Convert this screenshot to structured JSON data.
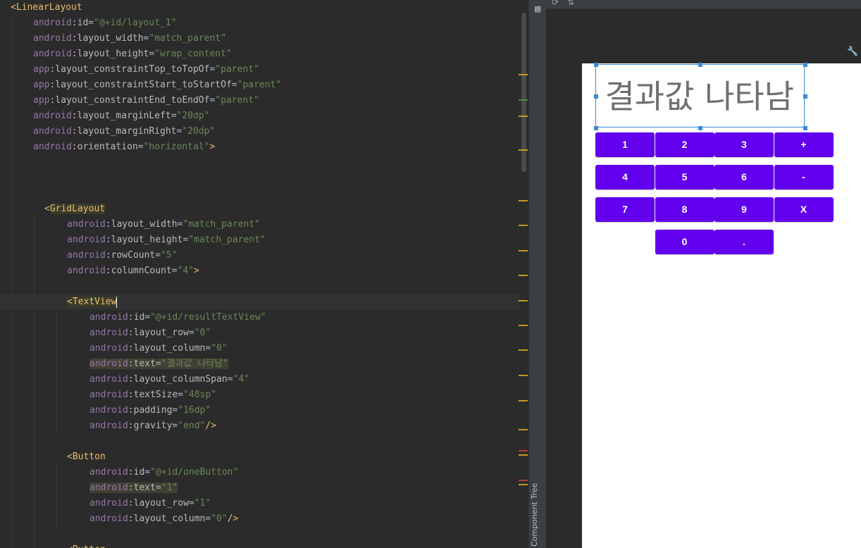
{
  "editor": {
    "lines": [
      {
        "indent": 0,
        "parts": [
          [
            "tag",
            "<LinearLayout"
          ]
        ]
      },
      {
        "indent": 1,
        "parts": [
          [
            "ns",
            "android"
          ],
          [
            "attr",
            ":id"
          ],
          [
            "eq",
            "="
          ],
          [
            "val",
            "\"@+id/layout_1\""
          ]
        ]
      },
      {
        "indent": 1,
        "parts": [
          [
            "ns",
            "android"
          ],
          [
            "attr",
            ":layout_width"
          ],
          [
            "eq",
            "="
          ],
          [
            "val",
            "\"match_parent\""
          ]
        ]
      },
      {
        "indent": 1,
        "parts": [
          [
            "ns",
            "android"
          ],
          [
            "attr",
            ":layout_height"
          ],
          [
            "eq",
            "="
          ],
          [
            "val",
            "\"wrap_content\""
          ]
        ]
      },
      {
        "indent": 1,
        "parts": [
          [
            "ns",
            "app"
          ],
          [
            "attr",
            ":layout_constraintTop_toTopOf"
          ],
          [
            "eq",
            "="
          ],
          [
            "val",
            "\"parent\""
          ]
        ]
      },
      {
        "indent": 1,
        "parts": [
          [
            "ns",
            "app"
          ],
          [
            "attr",
            ":layout_constraintStart_toStartOf"
          ],
          [
            "eq",
            "="
          ],
          [
            "val",
            "\"parent\""
          ]
        ]
      },
      {
        "indent": 1,
        "parts": [
          [
            "ns",
            "app"
          ],
          [
            "attr",
            ":layout_constraintEnd_toEndOf"
          ],
          [
            "eq",
            "="
          ],
          [
            "val",
            "\"parent\""
          ]
        ]
      },
      {
        "indent": 1,
        "parts": [
          [
            "ns",
            "android"
          ],
          [
            "attr",
            ":layout_marginLeft"
          ],
          [
            "eq",
            "="
          ],
          [
            "val",
            "\"20dp\""
          ]
        ]
      },
      {
        "indent": 1,
        "parts": [
          [
            "ns",
            "android"
          ],
          [
            "attr",
            ":layout_marginRight"
          ],
          [
            "eq",
            "="
          ],
          [
            "val",
            "\"20dp\""
          ]
        ]
      },
      {
        "indent": 1,
        "parts": [
          [
            "ns",
            "android"
          ],
          [
            "attr",
            ":orientation"
          ],
          [
            "eq",
            "="
          ],
          [
            "val",
            "\"horizontal\""
          ],
          [
            "tag",
            ">"
          ]
        ]
      },
      {
        "indent": 0,
        "parts": []
      },
      {
        "indent": 0,
        "parts": []
      },
      {
        "indent": 0,
        "parts": []
      },
      {
        "indent": 1.5,
        "parts": [
          [
            "tag",
            "<"
          ],
          [
            "taghl",
            "GridLayout"
          ]
        ]
      },
      {
        "indent": 2.5,
        "parts": [
          [
            "ns",
            "android"
          ],
          [
            "attr",
            ":layout_width"
          ],
          [
            "eq",
            "="
          ],
          [
            "val",
            "\"match_parent\""
          ]
        ]
      },
      {
        "indent": 2.5,
        "parts": [
          [
            "ns",
            "android"
          ],
          [
            "attr",
            ":layout_height"
          ],
          [
            "eq",
            "="
          ],
          [
            "val",
            "\"match_parent\""
          ]
        ]
      },
      {
        "indent": 2.5,
        "parts": [
          [
            "ns",
            "android"
          ],
          [
            "attr",
            ":rowCount"
          ],
          [
            "eq",
            "="
          ],
          [
            "val",
            "\"5\""
          ]
        ]
      },
      {
        "indent": 2.5,
        "parts": [
          [
            "ns",
            "android"
          ],
          [
            "attr",
            ":columnCount"
          ],
          [
            "eq",
            "="
          ],
          [
            "val",
            "\"4\""
          ],
          [
            "tag",
            ">"
          ]
        ]
      },
      {
        "indent": 0,
        "parts": []
      },
      {
        "indent": 2.5,
        "caret": true,
        "parts": [
          [
            "taghl",
            "<TextView"
          ],
          [
            "caret",
            ""
          ]
        ]
      },
      {
        "indent": 3.5,
        "parts": [
          [
            "ns",
            "android"
          ],
          [
            "attr",
            ":id"
          ],
          [
            "eq",
            "="
          ],
          [
            "val",
            "\"@+id/resultTextView\""
          ]
        ]
      },
      {
        "indent": 3.5,
        "parts": [
          [
            "ns",
            "android"
          ],
          [
            "attr",
            ":layout_row"
          ],
          [
            "eq",
            "="
          ],
          [
            "val",
            "\"0\""
          ]
        ]
      },
      {
        "indent": 3.5,
        "parts": [
          [
            "ns",
            "android"
          ],
          [
            "attr",
            ":layout_column"
          ],
          [
            "eq",
            "="
          ],
          [
            "val",
            "\"0\""
          ]
        ]
      },
      {
        "indent": 3.5,
        "parts": [
          [
            "nshl",
            "android"
          ],
          [
            "attrhl",
            ":text"
          ],
          [
            "eqhl",
            "="
          ],
          [
            "valhl",
            "\"결과값 나타남\""
          ]
        ]
      },
      {
        "indent": 3.5,
        "parts": [
          [
            "ns",
            "android"
          ],
          [
            "attr",
            ":layout_columnSpan"
          ],
          [
            "eq",
            "="
          ],
          [
            "val",
            "\"4\""
          ]
        ]
      },
      {
        "indent": 3.5,
        "parts": [
          [
            "ns",
            "android"
          ],
          [
            "attr",
            ":textSize"
          ],
          [
            "eq",
            "="
          ],
          [
            "val",
            "\"48sp\""
          ]
        ]
      },
      {
        "indent": 3.5,
        "parts": [
          [
            "ns",
            "android"
          ],
          [
            "attr",
            ":padding"
          ],
          [
            "eq",
            "="
          ],
          [
            "val",
            "\"16dp\""
          ]
        ]
      },
      {
        "indent": 3.5,
        "parts": [
          [
            "ns",
            "android"
          ],
          [
            "attr",
            ":gravity"
          ],
          [
            "eq",
            "="
          ],
          [
            "val",
            "\"end\""
          ],
          [
            "tag",
            "/>"
          ]
        ]
      },
      {
        "indent": 0,
        "parts": []
      },
      {
        "indent": 2.5,
        "parts": [
          [
            "tag",
            "<Button"
          ]
        ]
      },
      {
        "indent": 3.5,
        "parts": [
          [
            "ns",
            "android"
          ],
          [
            "attr",
            ":id"
          ],
          [
            "eq",
            "="
          ],
          [
            "val",
            "\"@+id/oneButton\""
          ]
        ]
      },
      {
        "indent": 3.5,
        "parts": [
          [
            "nshl",
            "android"
          ],
          [
            "attrhl",
            ":text"
          ],
          [
            "eqhl",
            "="
          ],
          [
            "valhl",
            "\"1\""
          ]
        ]
      },
      {
        "indent": 3.5,
        "parts": [
          [
            "ns",
            "android"
          ],
          [
            "attr",
            ":layout_row"
          ],
          [
            "eq",
            "="
          ],
          [
            "val",
            "\"1\""
          ]
        ]
      },
      {
        "indent": 3.5,
        "parts": [
          [
            "ns",
            "android"
          ],
          [
            "attr",
            ":layout_column"
          ],
          [
            "eq",
            "="
          ],
          [
            "val",
            "\"0\""
          ],
          [
            "tag",
            "/>"
          ]
        ]
      },
      {
        "indent": 0,
        "parts": []
      },
      {
        "indent": 2.5,
        "parts": [
          [
            "tag",
            "<Button"
          ]
        ]
      }
    ],
    "markers": [
      {
        "color": "#c49a1f",
        "at": 105
      },
      {
        "color": "#4a8c3f",
        "at": 141
      },
      {
        "color": "#c49a1f",
        "at": 164
      },
      {
        "color": "#c49a1f",
        "at": 212
      },
      {
        "color": "#c49a1f",
        "at": 284
      },
      {
        "color": "#c49a1f",
        "at": 319
      },
      {
        "color": "#c49a1f",
        "at": 355
      },
      {
        "color": "#c49a1f",
        "at": 390
      },
      {
        "color": "#c49a1f",
        "at": 426
      },
      {
        "color": "#c49a1f",
        "at": 461
      },
      {
        "color": "#c49a1f",
        "at": 496
      },
      {
        "color": "#c49a1f",
        "at": 532
      },
      {
        "color": "#c49a1f",
        "at": 568
      },
      {
        "color": "#c49a1f",
        "at": 609
      },
      {
        "color": "#b33a3a",
        "at": 639
      },
      {
        "color": "#c49a1f",
        "at": 645
      },
      {
        "color": "#b33a3a",
        "at": 681
      },
      {
        "color": "#c49a1f",
        "at": 687
      }
    ]
  },
  "side_strip": {
    "component_tree_label": "Component Tree",
    "palette_icon": "palette-icon"
  },
  "design": {
    "toolbar_icons": [
      "orientation-icon",
      "arrows-icon"
    ],
    "wrench_icon": "wrench-icon",
    "result_text": "결과값 나타남",
    "button_color": "#6200ee",
    "selection_color": "#3d8bd9",
    "buttons": [
      {
        "label": "1",
        "row": 0,
        "col": 0
      },
      {
        "label": "2",
        "row": 0,
        "col": 1
      },
      {
        "label": "3",
        "row": 0,
        "col": 2
      },
      {
        "label": "+",
        "row": 0,
        "col": 3
      },
      {
        "label": "4",
        "row": 1,
        "col": 0
      },
      {
        "label": "5",
        "row": 1,
        "col": 1
      },
      {
        "label": "6",
        "row": 1,
        "col": 2
      },
      {
        "label": "-",
        "row": 1,
        "col": 3
      },
      {
        "label": "7",
        "row": 2,
        "col": 0
      },
      {
        "label": "8",
        "row": 2,
        "col": 1
      },
      {
        "label": "9",
        "row": 2,
        "col": 2
      },
      {
        "label": "X",
        "row": 2,
        "col": 3
      },
      {
        "label": "0",
        "row": 3,
        "col": 1
      },
      {
        "label": ".",
        "row": 3,
        "col": 2
      }
    ]
  }
}
